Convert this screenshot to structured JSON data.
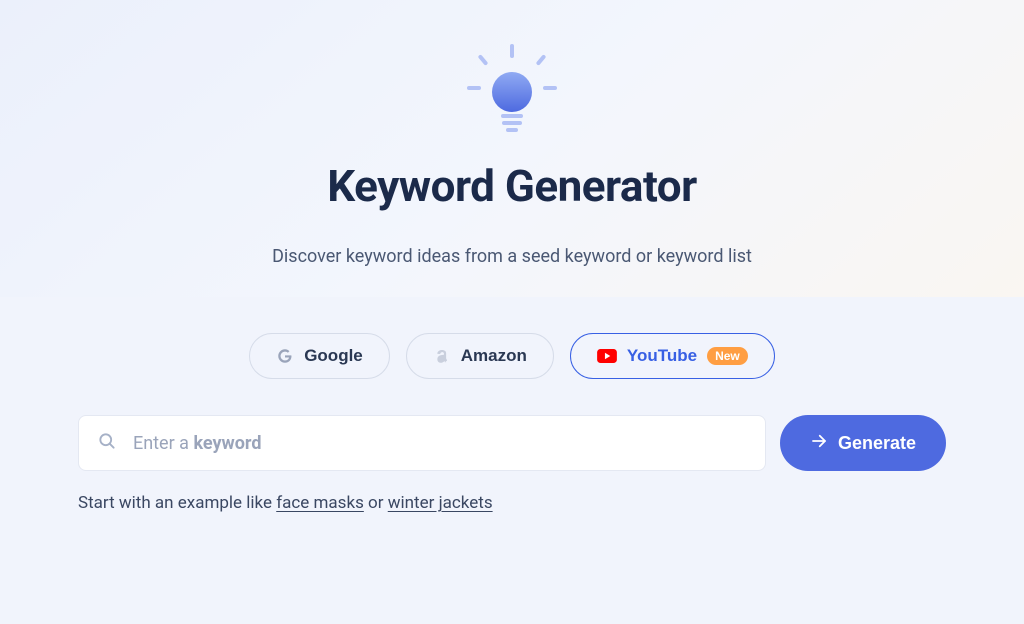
{
  "hero": {
    "title": "Keyword Generator",
    "subtitle": "Discover keyword ideas from a seed keyword or keyword list"
  },
  "tabs": {
    "google": "Google",
    "amazon": "Amazon",
    "youtube": "YouTube",
    "youtube_badge": "New"
  },
  "search": {
    "placeholder_prefix": "Enter a ",
    "placeholder_bold": "keyword"
  },
  "generate_label": "Generate",
  "example": {
    "prefix": "Start with an example like ",
    "link1": "face masks",
    "middle": " or ",
    "link2": "winter jackets"
  }
}
